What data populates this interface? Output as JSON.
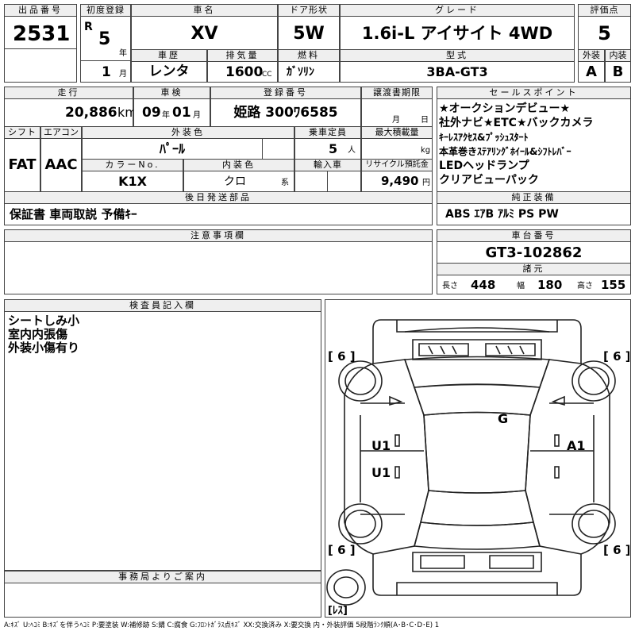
{
  "header": {
    "lot_label": "出品番号",
    "lot": "2531",
    "first_reg_label": "初度登録",
    "era": "R",
    "reg_year": "5",
    "year_unit": "年",
    "reg_month": "1",
    "month_unit": "月",
    "car_name_label": "車名",
    "car_name": "XV",
    "door_label": "ドア形状",
    "door": "5W",
    "grade_label": "グレード",
    "grade": "1.6i-L アイサイト 4WD",
    "score_label": "評価点",
    "score": "5",
    "history_label": "車歴",
    "history": "レンタ",
    "displacement_label": "排気量",
    "displacement": "1600",
    "displacement_unit": "CC",
    "fuel_label": "燃料",
    "fuel": "ｶﾞｿﾘﾝ",
    "model_label": "型式",
    "model": "3BA-GT3",
    "exterior_label": "外装",
    "exterior": "A",
    "interior_label": "内装",
    "interior": "B"
  },
  "row2": {
    "mileage_label": "走行",
    "mileage": "20,886",
    "mileage_unit": "km",
    "inspection_label": "車検",
    "insp_year": "09",
    "insp_year_unit": "年",
    "insp_month": "01",
    "insp_month_unit": "月",
    "plate_label": "登録番号",
    "plate": "姫路 300ﾜ6585",
    "transfer_label": "譲渡書期限",
    "transfer_month_unit": "月",
    "transfer_day_unit": "日",
    "shift_label": "シフト",
    "shift": "FAT",
    "ac_label": "エアコン",
    "ac": "AAC",
    "ext_color_label": "外装色",
    "ext_color": "ﾊﾟｰﾙ",
    "capacity_label": "乗車定員",
    "capacity": "5",
    "capacity_unit": "人",
    "max_load_label": "最大積載量",
    "max_load_unit": "kg",
    "color_no_label": "カラーNo.",
    "color_no": "K1X",
    "int_color_label": "内装色",
    "int_color": "クロ",
    "int_color_unit": "系",
    "import_label": "輸入車",
    "recycle_label": "リサイクル預託金",
    "recycle": "9,490",
    "recycle_unit": "円",
    "later_parts_label": "後日発送部品",
    "later_parts": "保証書 車両取説 予備ｷｰ"
  },
  "sales_points": {
    "label": "セールスポイント",
    "lines": [
      "★オークションデビュー★",
      "社外ナビ★ETC★バックカメラ",
      "ｷｰﾚｽｱｸｾｽ&ﾌﾟｯｼｭｽﾀｰﾄ",
      "本革巻きｽﾃｱﾘﾝｸﾞﾎｲｰﾙ&ｼﾌﾄﾚﾊﾞｰ",
      "LEDヘッドランプ",
      "クリアビューパック"
    ]
  },
  "equipment": {
    "label": "純正装備",
    "value": "ABS ｴｱB ｱﾙﾐ PS PW"
  },
  "caution": {
    "label": "注意事項欄"
  },
  "chassis": {
    "label": "車台番号",
    "value": "GT3-102862",
    "dims_label": "諸元",
    "length_label": "長さ",
    "length": "448",
    "width_label": "幅",
    "width": "180",
    "height_label": "高さ",
    "height": "155"
  },
  "inspector": {
    "label": "検査員記入欄",
    "lines": [
      "シートしみ小",
      "室内内張傷",
      "外装小傷有り"
    ]
  },
  "office": {
    "label": "事務局よりご案内"
  },
  "diagram": {
    "tire_fl": "[ 6 ]",
    "tire_fr": "[ 6 ]",
    "tire_rl": "[ 6 ]",
    "tire_rr": "[ 6 ]",
    "roof_mark": "G",
    "left_front_mark": "U1",
    "left_rear_mark": "U1",
    "right_front_mark": "A1",
    "spare": "[ﾚｽ]"
  },
  "legend": "A:ｷｽﾞ U:ﾍｺﾐ B:ｷｽﾞを伴うﾍｺﾐ P:要塗装 W:補修跡 S:錆 C:腐食 G:ﾌﾛﾝﾄｶﾞﾗｽ点ｷｽﾞ XX:交換済み X:要交換 内・外装評価 5段階ﾗﾝｸ順(A･B･C･D･E) 1"
}
